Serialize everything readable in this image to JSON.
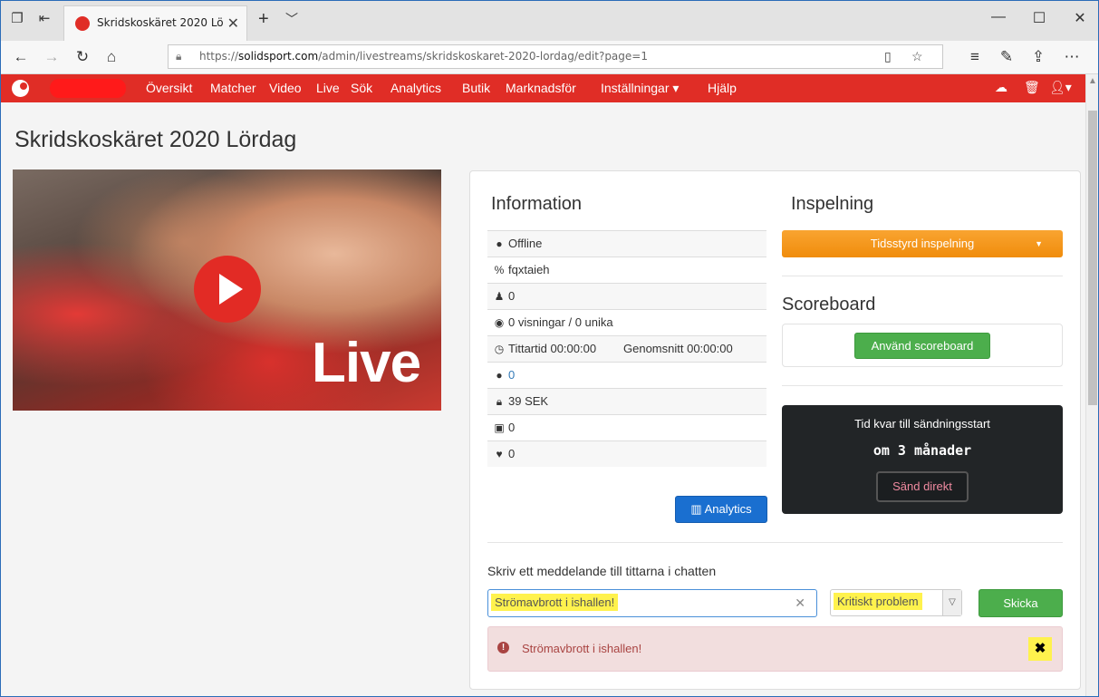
{
  "browser": {
    "tab_title": "Skridskoskäret 2020 Lör",
    "url_prefix": "https://",
    "url_domain": "solidsport.com",
    "url_path": "/admin/livestreams/skridskoskaret-2020-lordag/edit?page=1"
  },
  "nav": {
    "items": [
      "Översikt",
      "Matcher",
      "Video",
      "Live",
      "Sök",
      "Analytics",
      "Butik",
      "Marknadsför",
      "Inställningar ▾",
      "Hjälp"
    ]
  },
  "page": {
    "title": "Skridskoskäret 2020 Lördag",
    "hero_text": "Live"
  },
  "info": {
    "heading": "Information",
    "status": "Offline",
    "key": "fqxtaieh",
    "users": "0",
    "views": "0 visningar / 0 unika",
    "watch_time": "Tittartid 00:00:00",
    "average": "Genomsnitt  00:00:00",
    "comments": "0",
    "price": "39 SEK",
    "tickets": "0",
    "likes": "0",
    "analytics_button": "Analytics"
  },
  "recording": {
    "heading": "Inspelning",
    "button": "Tidsstyrd inspelning"
  },
  "scoreboard": {
    "heading": "Scoreboard",
    "button": "Använd scoreboard"
  },
  "countdown": {
    "label": "Tid kvar till sändningsstart",
    "value": "om 3 månader",
    "button": "Sänd direkt"
  },
  "chat": {
    "label": "Skriv ett meddelande till tittarna i chatten",
    "input_value": "Strömavbrott i ishallen!",
    "severity": "Kritiskt problem",
    "send_button": "Skicka",
    "alert_text": "Strömavbrott i ishallen!"
  },
  "colors": {
    "brand_red": "#e02d26",
    "orange": "#f08c0b",
    "green": "#4cae4c",
    "highlight": "#fff24d"
  }
}
